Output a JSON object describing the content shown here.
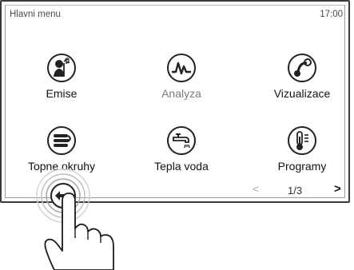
{
  "header": {
    "title": "Hlavni menu",
    "time": "17:00"
  },
  "menu": {
    "items": [
      {
        "label": "Emise",
        "icon": "chimney-sweep-icon",
        "enabled": true
      },
      {
        "label": "Analyza",
        "icon": "analysis-graph-icon",
        "enabled": false
      },
      {
        "label": "Vizualizace",
        "icon": "visualization-icon",
        "enabled": true
      },
      {
        "label": "Topne okruhy",
        "icon": "heating-circuits-icon",
        "enabled": true
      },
      {
        "label": "Tepla voda",
        "icon": "hot-water-tap-icon",
        "enabled": true
      },
      {
        "label": "Programy",
        "icon": "thermometer-programs-icon",
        "enabled": true
      }
    ]
  },
  "pager": {
    "prev": "<",
    "page": "1/3",
    "next": ">"
  },
  "colors": {
    "frame": "#3a3a3a",
    "text": "#111111",
    "muted": "#7a7a7a",
    "icon": "#222222"
  }
}
